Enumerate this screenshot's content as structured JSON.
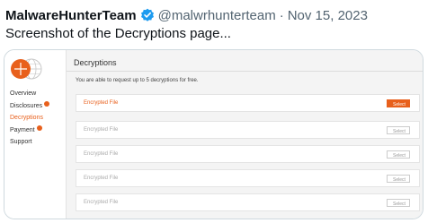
{
  "tweet": {
    "author_name": "MalwareHunterTeam",
    "handle": "@malwrhunterteam",
    "separator": "·",
    "date": "Nov 15, 2023",
    "text": "Screenshot of the Decryptions page..."
  },
  "colors": {
    "accent": "#e8601c",
    "verified": "#1d9bf0"
  },
  "sidebar": {
    "logo": "orange-globe-logo",
    "items": [
      {
        "label": "Overview",
        "badge": false,
        "active": false
      },
      {
        "label": "Disclosures",
        "badge": true,
        "active": false
      },
      {
        "label": "Decryptions",
        "badge": false,
        "active": true
      },
      {
        "label": "Payment",
        "badge": true,
        "active": false
      },
      {
        "label": "Support",
        "badge": false,
        "active": false
      }
    ]
  },
  "main": {
    "title": "Decryptions",
    "intro": "You are able to request up to 5 decryptions for free.",
    "files": [
      {
        "label": "Encrypted File",
        "button": "Select",
        "active": true
      },
      {
        "label": "Encrypted File",
        "button": "Select",
        "active": false
      },
      {
        "label": "Encrypted File",
        "button": "Select",
        "active": false
      },
      {
        "label": "Encrypted File",
        "button": "Select",
        "active": false
      },
      {
        "label": "Encrypted File",
        "button": "Select",
        "active": false
      }
    ]
  }
}
